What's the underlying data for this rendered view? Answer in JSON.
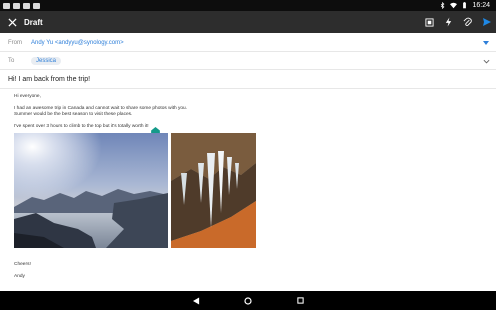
{
  "status_bar": {
    "time": "16:24",
    "left_icons": [
      "app-notification-icon",
      "image-notification-icon",
      "photo-notification-icon",
      "download-notification-icon"
    ],
    "right_icons": [
      "bluetooth-icon",
      "wifi-icon",
      "battery-icon"
    ]
  },
  "toolbar": {
    "title": "Draft",
    "background": "#2d2d2d",
    "actions": [
      "insert-image-icon",
      "flash-icon",
      "attach-icon",
      "send-icon"
    ],
    "send_color": "#1e88e5"
  },
  "compose": {
    "from_label": "From",
    "from_value": "Andy Yu <andyyu@synology.com>",
    "to_label": "To",
    "to_chip": "Jessica",
    "subject": "Hi! I am back from the trip!",
    "link_color": "#2e7fd9"
  },
  "body": {
    "greeting": "Hi everyone,",
    "line1": "I had an awesome trip in Canada and cannot wait to share some photos with you.",
    "line2": "Summer would be the best season to visit these places.",
    "line3": "I've spent over 3 hours to climb to the top but it's totally worth it!",
    "signoff": "Cheers!",
    "signature": "Andy"
  },
  "images": [
    "mountain-lake-photo",
    "icicles-photo"
  ]
}
